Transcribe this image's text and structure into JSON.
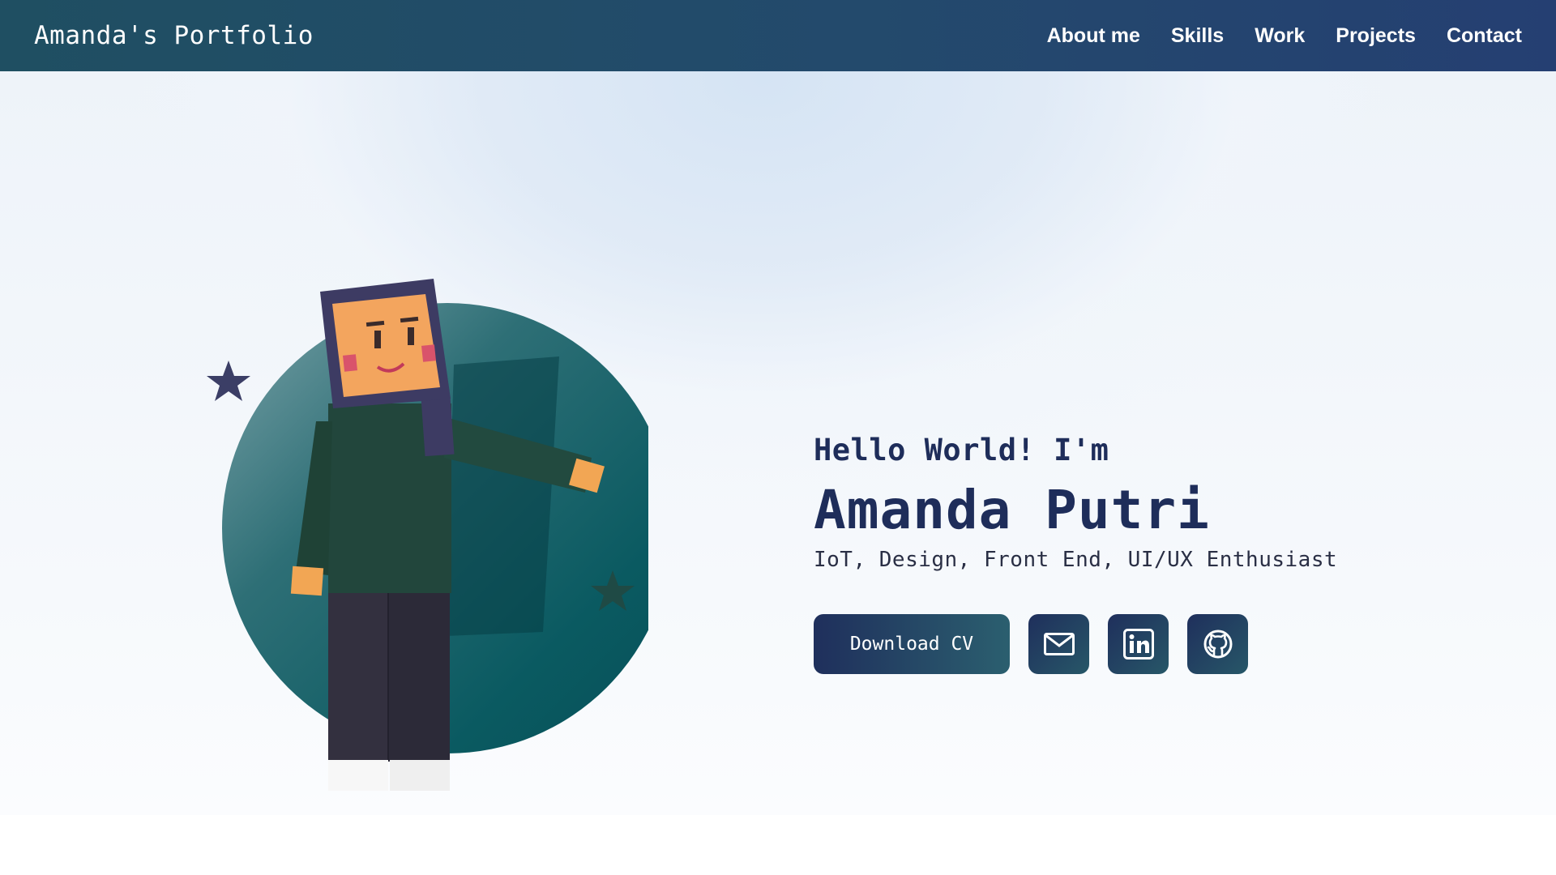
{
  "nav": {
    "brand": "Amanda's Portfolio",
    "links": [
      "About me",
      "Skills",
      "Work",
      "Projects",
      "Contact"
    ]
  },
  "hero": {
    "greeting": "Hello World! I'm",
    "name": "Amanda Putri",
    "tagline": "IoT, Design, Front End, UI/UX Enthusiast",
    "cv_button": "Download CV",
    "icons": [
      "mail-icon",
      "linkedin-icon",
      "github-icon"
    ]
  },
  "colors": {
    "nav_start": "#1f4f62",
    "nav_end": "#253f72",
    "heading": "#1e2d5a",
    "circle": "#0b5c63",
    "button": "#1f2f5c"
  }
}
